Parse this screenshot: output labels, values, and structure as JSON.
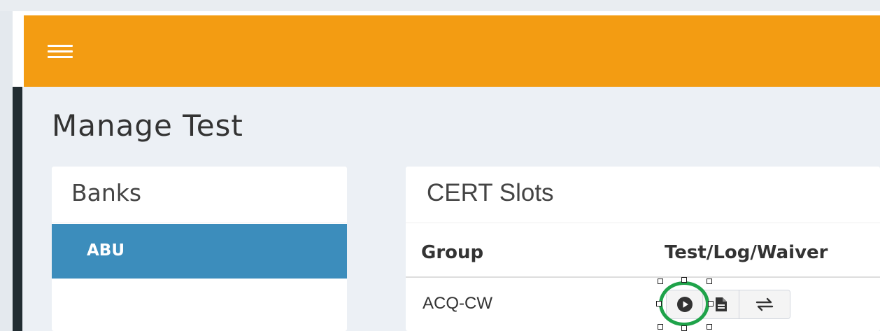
{
  "page": {
    "title": "Manage Test"
  },
  "banks_panel": {
    "title": "Banks",
    "items": [
      {
        "label": "ABU",
        "active": true
      }
    ]
  },
  "slots_panel": {
    "title": "CERT Slots",
    "columns": [
      "Group",
      "Test/Log/Waiver"
    ],
    "rows": [
      {
        "group": "ACQ-CW",
        "actions": [
          {
            "icon": "play-circle-icon",
            "tooltip": "Test"
          },
          {
            "icon": "document-icon",
            "tooltip": "Log"
          },
          {
            "icon": "transfer-arrows-icon",
            "tooltip": "Waiver"
          }
        ]
      }
    ]
  },
  "colors": {
    "header": "#f39c12",
    "active_item": "#3c8dbc",
    "content_bg": "#ecf0f5",
    "sidebar_dark": "#222d32",
    "highlight_ring": "#1fa34a"
  }
}
